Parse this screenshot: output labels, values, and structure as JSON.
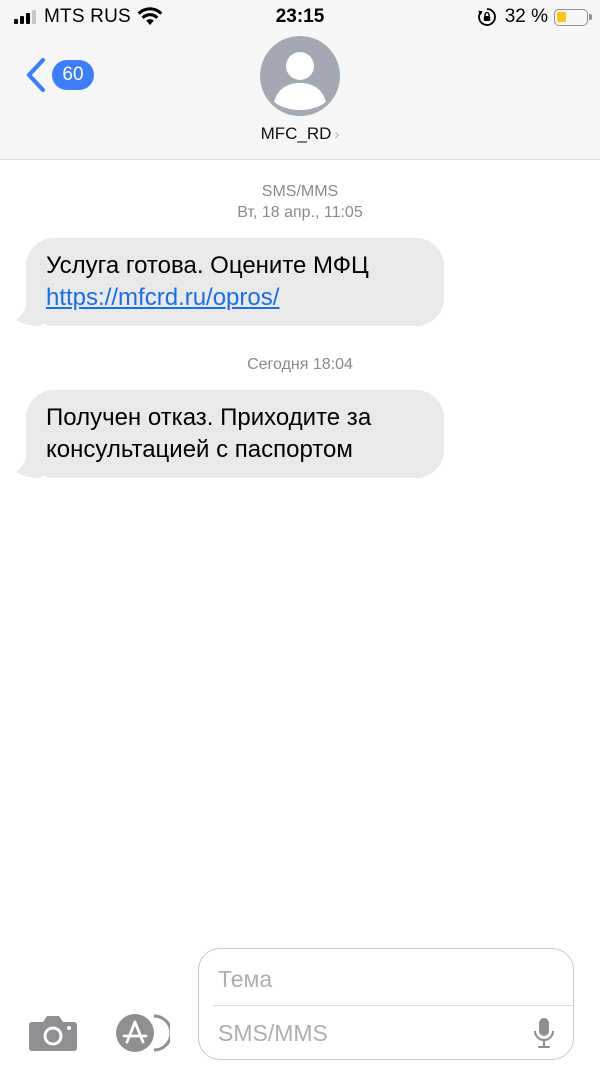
{
  "status_bar": {
    "carrier": "MTS RUS",
    "time": "23:15",
    "battery_percent": "32 %",
    "battery_level": 0.32
  },
  "nav": {
    "back_badge": "60",
    "contact_name": "MFC_RD",
    "contact_chevron": "›"
  },
  "icons": {
    "signal": "signal-bars-icon",
    "wifi": "wifi-icon",
    "rotation_lock": "rotation-lock-icon",
    "battery": "battery-icon",
    "back": "chevron-left-icon",
    "avatar": "person-silhouette-icon",
    "camera": "camera-icon",
    "app_store": "app-store-icon",
    "microphone": "microphone-icon"
  },
  "conversation": {
    "header_1": {
      "channel": "SMS/MMS",
      "date": "Вт, 18 апр., 11:05"
    },
    "header_2": {
      "date": "Сегодня 18:04"
    },
    "messages": [
      {
        "line1": "Услуга готова. Оцените МФЦ",
        "link": "https://mfcrd.ru/opros/"
      },
      {
        "line1": "Получен отказ. Приходите за",
        "line2": "консультацией с паспортом"
      }
    ]
  },
  "compose": {
    "subject_placeholder": "Тема",
    "message_placeholder": "SMS/MMS"
  },
  "colors": {
    "accent": "#3b7ef8",
    "link": "#1b6fe0",
    "bubble_incoming": "#e9e9eb",
    "header_bg": "#f6f6f6",
    "battery_low": "#f5c518"
  }
}
